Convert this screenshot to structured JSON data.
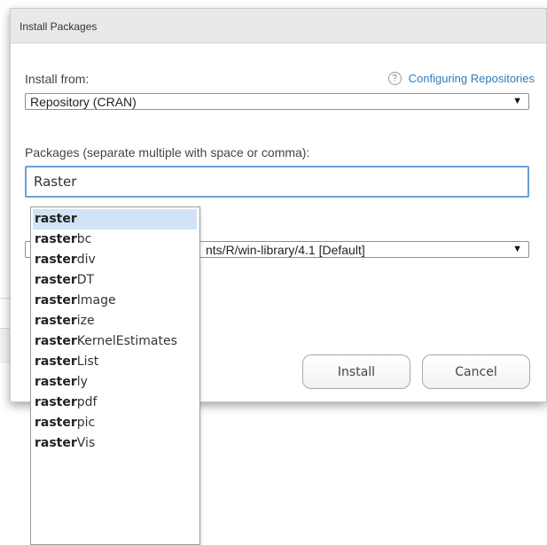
{
  "dialog": {
    "title": "Install Packages",
    "install_from_label": "Install from:",
    "help_icon_text": "?",
    "help_link": "Configuring Repositories",
    "install_from_value": "Repository (CRAN)",
    "packages_label": "Packages (separate multiple with space or comma):",
    "packages_value": "Raster",
    "library_value_visible": "nts/R/win-library/4.1 [Default]",
    "caret": "▼",
    "install_button": "Install",
    "cancel_button": "Cancel"
  },
  "autocomplete": {
    "query": "raster",
    "selected_index": 0,
    "items": [
      {
        "match": "raster",
        "rest": ""
      },
      {
        "match": "raster",
        "rest": "bc"
      },
      {
        "match": "raster",
        "rest": "div"
      },
      {
        "match": "raster",
        "rest": "DT"
      },
      {
        "match": "raster",
        "rest": "Image"
      },
      {
        "match": "raster",
        "rest": "ize"
      },
      {
        "match": "raster",
        "rest": "KernelEstimates"
      },
      {
        "match": "raster",
        "rest": "List"
      },
      {
        "match": "raster",
        "rest": "ly"
      },
      {
        "match": "raster",
        "rest": "pdf"
      },
      {
        "match": "raster",
        "rest": "pic"
      },
      {
        "match": "raster",
        "rest": "Vis"
      }
    ]
  },
  "colors": {
    "link": "#2f7bbf",
    "focus_border": "#6c9fd6",
    "selected_row": "#d2e3f5",
    "titlebar": "#e9e9e9"
  }
}
